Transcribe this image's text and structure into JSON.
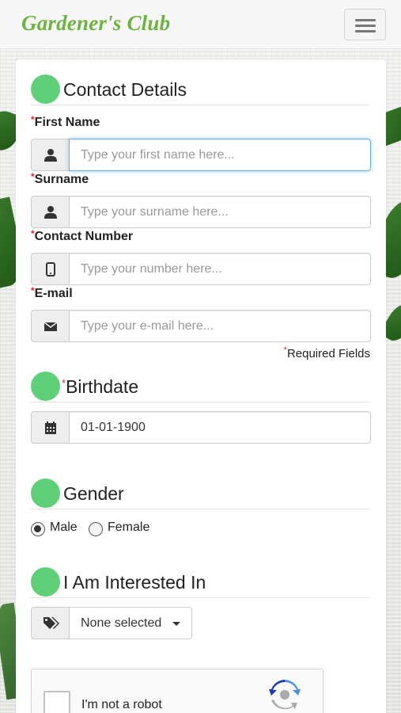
{
  "navbar": {
    "brand": "Gardener's Club",
    "menu_icon": "hamburger-menu-icon"
  },
  "contact": {
    "heading": "Contact Details",
    "first_name": {
      "label": "First Name",
      "placeholder": "Type your first name here...",
      "icon": "user-icon"
    },
    "surname": {
      "label": "Surname",
      "placeholder": "Type your surname here...",
      "icon": "user-icon"
    },
    "contact_number": {
      "label": "Contact Number",
      "placeholder": "Type your number here...",
      "icon": "mobile-phone-icon"
    },
    "email": {
      "label": "E-mail",
      "placeholder": "Type your e-mail here...",
      "icon": "envelope-icon"
    },
    "required_note": "Required Fields",
    "required_marker": "*"
  },
  "birthdate": {
    "heading": "Birthdate",
    "value": "01-01-1900",
    "icon": "calendar-icon"
  },
  "gender": {
    "heading": "Gender",
    "options": [
      {
        "label": "Male",
        "selected": true
      },
      {
        "label": "Female",
        "selected": false
      }
    ]
  },
  "interests": {
    "heading": "I Am Interested In",
    "selected_text": "None selected",
    "icon": "tags-icon"
  },
  "recaptcha": {
    "label": "I'm not a robot",
    "icon": "recaptcha-logo-icon"
  },
  "colors": {
    "brand": "#6db33f",
    "section_dot": "#5fcf7a",
    "required": "#d62a2a",
    "focus": "#66afe9"
  }
}
